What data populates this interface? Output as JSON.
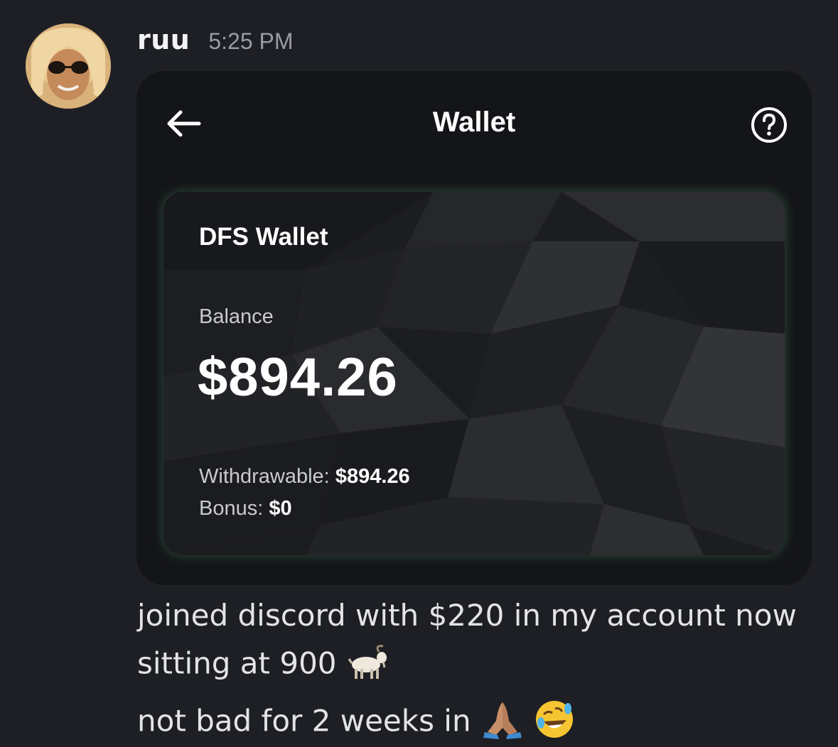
{
  "message": {
    "username": "ruu",
    "timestamp": "5:25 PM",
    "avatar_icon": "user-avatar-sunglasses",
    "text_lines": [
      "joined discord with $220 in my account now",
      "sitting at 900",
      "not bad for 2 weeks in"
    ],
    "emojis": {
      "line2": [
        "goat-emoji"
      ],
      "line3": [
        "folded-hands-emoji",
        "rolling-on-floor-laughing-emoji"
      ]
    }
  },
  "embed": {
    "header": {
      "title": "Wallet",
      "back_icon": "arrow-left-icon",
      "help_icon": "question-circle-icon"
    },
    "card": {
      "name": "DFS Wallet",
      "balance_label": "Balance",
      "balance_amount": "$894.26",
      "withdrawable_label": "Withdrawable:",
      "withdrawable_amount": "$894.26",
      "bonus_label": "Bonus:",
      "bonus_amount": "$0",
      "glow_color": "#4f9a6e"
    }
  },
  "colors": {
    "background": "#1e1f24",
    "embed_background": "#141518",
    "username": "#f2f3f5",
    "timestamp": "#9a9ca3",
    "message_text": "#e3e4e7"
  }
}
